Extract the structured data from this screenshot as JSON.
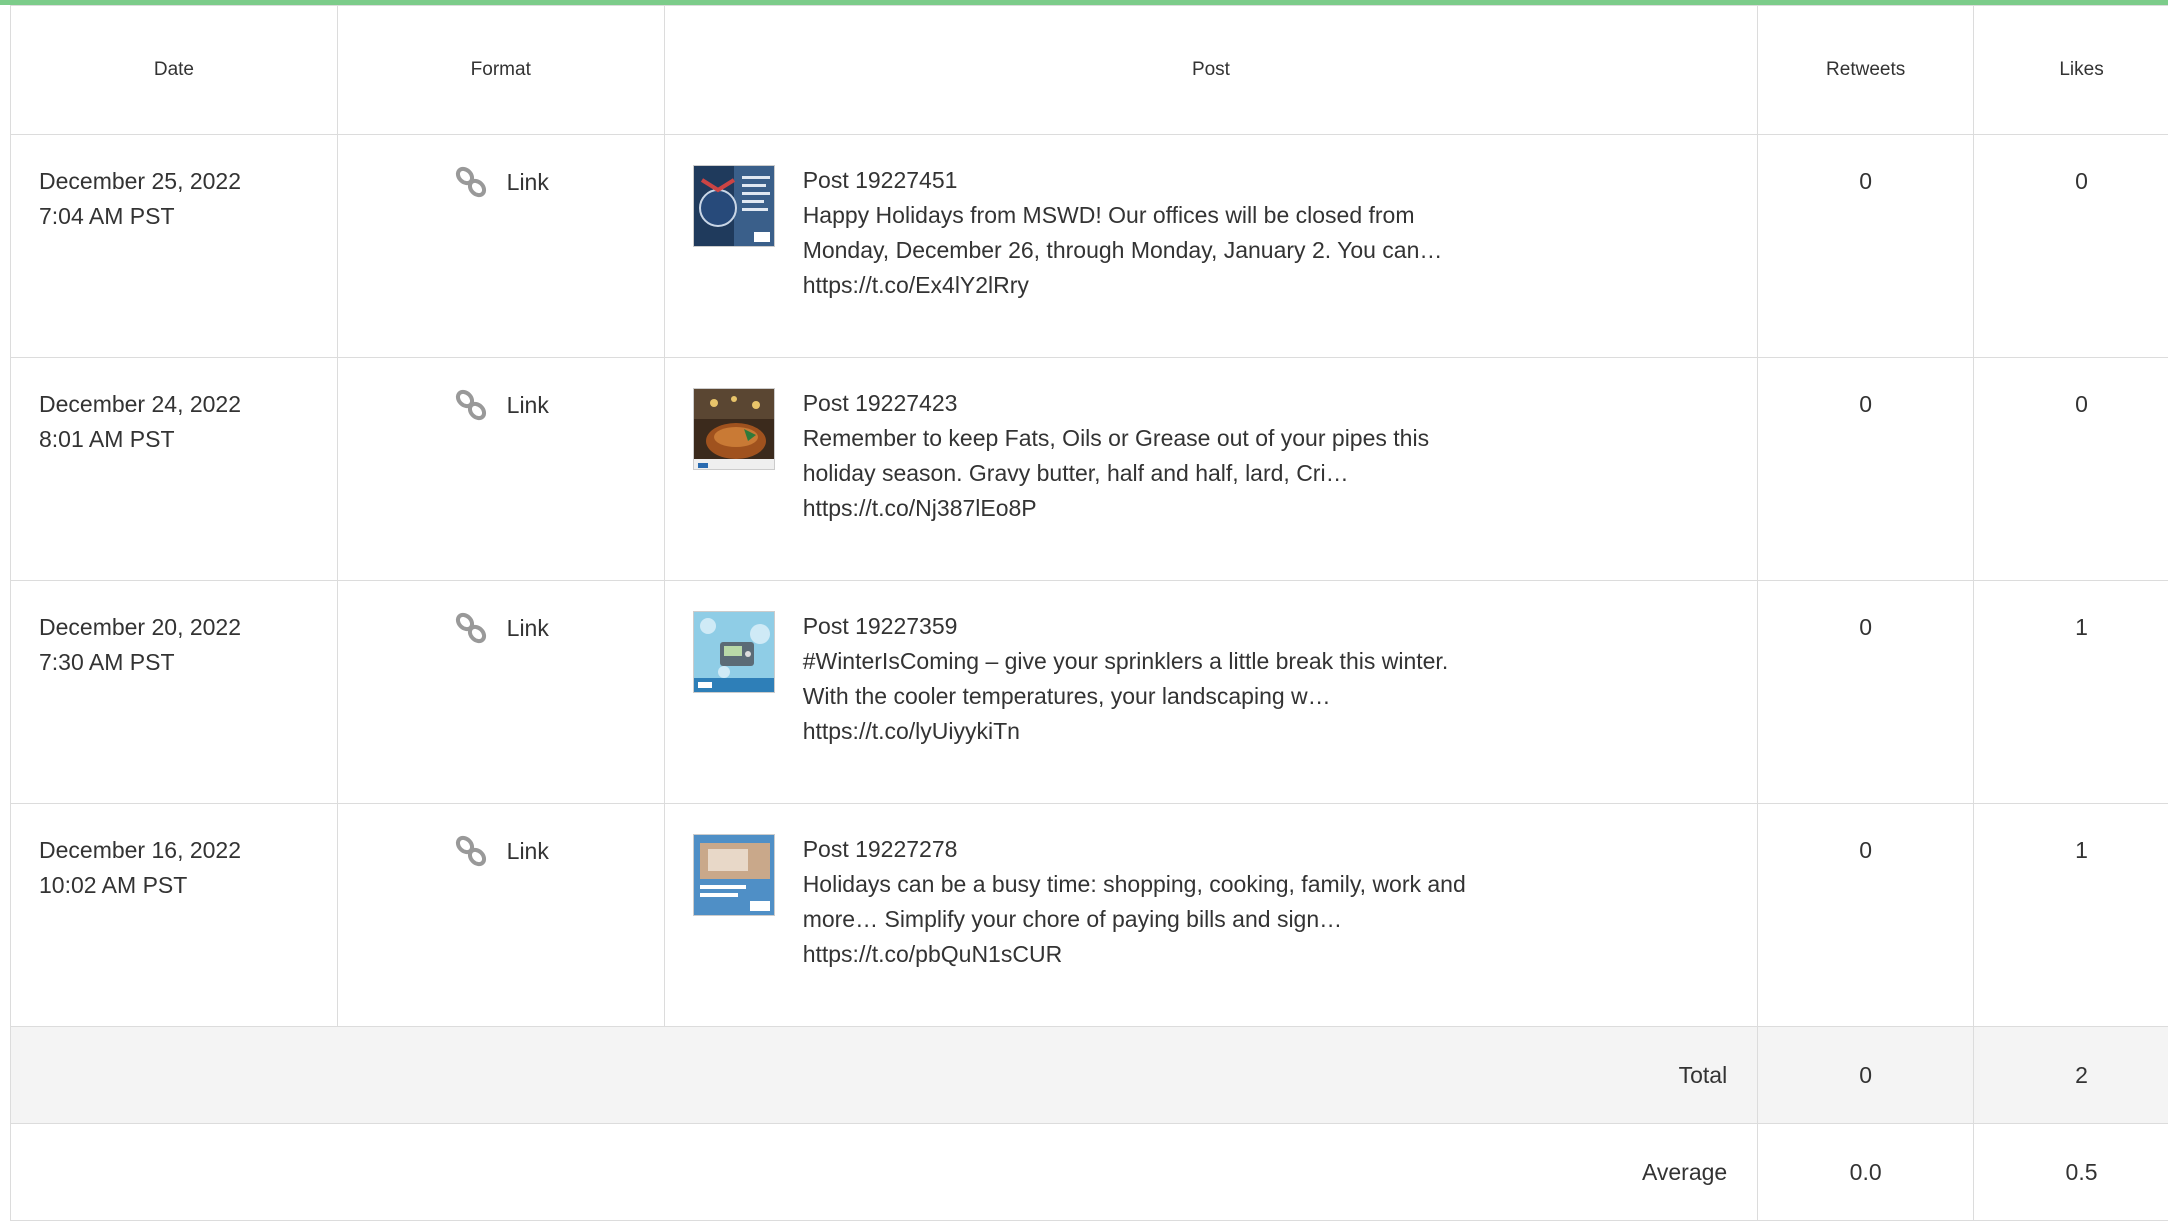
{
  "headers": {
    "date": "Date",
    "format": "Format",
    "post": "Post",
    "retweets": "Retweets",
    "likes": "Likes"
  },
  "colors": {
    "accent": "#7ccc8a",
    "border": "#dcdcdc",
    "total_bg": "#f4f4f4"
  },
  "rows": [
    {
      "date": "December 25, 2022",
      "time": "7:04 AM PST",
      "format_icon": "link-icon",
      "format": "Link",
      "title": "Post 19227451",
      "line1": "Happy Holidays from MSWD! Our offices will be closed from",
      "line2": "Monday, December 26, through Monday, January 2. You can…",
      "url": "https://t.co/Ex4lY2lRry",
      "retweets": "0",
      "likes": "0"
    },
    {
      "date": "December 24, 2022",
      "time": "8:01 AM PST",
      "format_icon": "link-icon",
      "format": "Link",
      "title": "Post 19227423",
      "line1": "Remember to keep Fats, Oils or Grease out of your pipes this",
      "line2": "holiday season. Gravy butter, half and half, lard, Cri…",
      "url": "https://t.co/Nj387lEo8P",
      "retweets": "0",
      "likes": "0"
    },
    {
      "date": "December 20, 2022",
      "time": "7:30 AM PST",
      "format_icon": "link-icon",
      "format": "Link",
      "title": "Post 19227359",
      "line1": "#WinterIsComing – give your sprinklers a little break this winter.",
      "line2": "With the cooler temperatures, your landscaping w…",
      "url": "https://t.co/lyUiyykiTn",
      "retweets": "0",
      "likes": "1"
    },
    {
      "date": "December 16, 2022",
      "time": "10:02 AM PST",
      "format_icon": "link-icon",
      "format": "Link",
      "title": "Post 19227278",
      "line1": "Holidays can be a busy time: shopping, cooking, family, work and",
      "line2": "more… Simplify your chore of paying bills and sign…",
      "url": "https://t.co/pbQuN1sCUR",
      "retweets": "0",
      "likes": "1"
    }
  ],
  "total": {
    "label": "Total",
    "retweets": "0",
    "likes": "2"
  },
  "average": {
    "label": "Average",
    "retweets": "0.0",
    "likes": "0.5"
  }
}
